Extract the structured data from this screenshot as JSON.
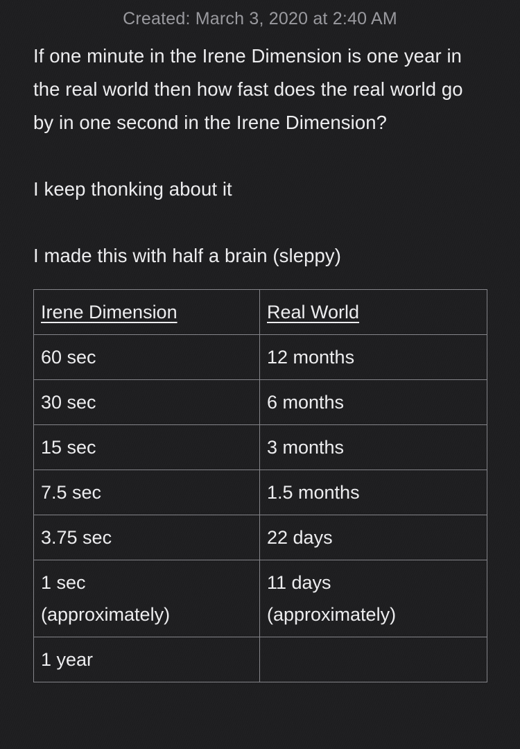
{
  "header": {
    "created_label": "Created: March 3, 2020 at 2:40 AM"
  },
  "note": {
    "paragraphs": [
      "If one minute in the Irene Dimension is one year in the real world then how fast does the real world go by in one second in the Irene Dimension?",
      "I keep thonking about it",
      "I made this with half a brain (sleppy)"
    ]
  },
  "table": {
    "columns": [
      {
        "label": "Irene Dimension"
      },
      {
        "label": "Real World"
      }
    ],
    "rows": [
      {
        "irene": "60 sec",
        "irene2": "",
        "real": "12 months",
        "real2": ""
      },
      {
        "irene": "30 sec",
        "irene2": "",
        "real": "6 months",
        "real2": ""
      },
      {
        "irene": "15 sec",
        "irene2": "",
        "real": "3 months",
        "real2": ""
      },
      {
        "irene": "7.5 sec",
        "irene2": "",
        "real": "1.5 months",
        "real2": ""
      },
      {
        "irene": "3.75 sec",
        "irene2": "",
        "real": "22 days",
        "real2": ""
      },
      {
        "irene": "1 sec",
        "irene2": "(approximately)",
        "real": "11 days",
        "real2": "(approximately)"
      },
      {
        "irene": "1 year",
        "irene2": "",
        "real": "",
        "real2": ""
      }
    ]
  },
  "colors": {
    "background": "#1d1d1f",
    "body_text": "#f1f1f3",
    "header_text": "#9b9ba0",
    "table_border": "#86868b"
  }
}
